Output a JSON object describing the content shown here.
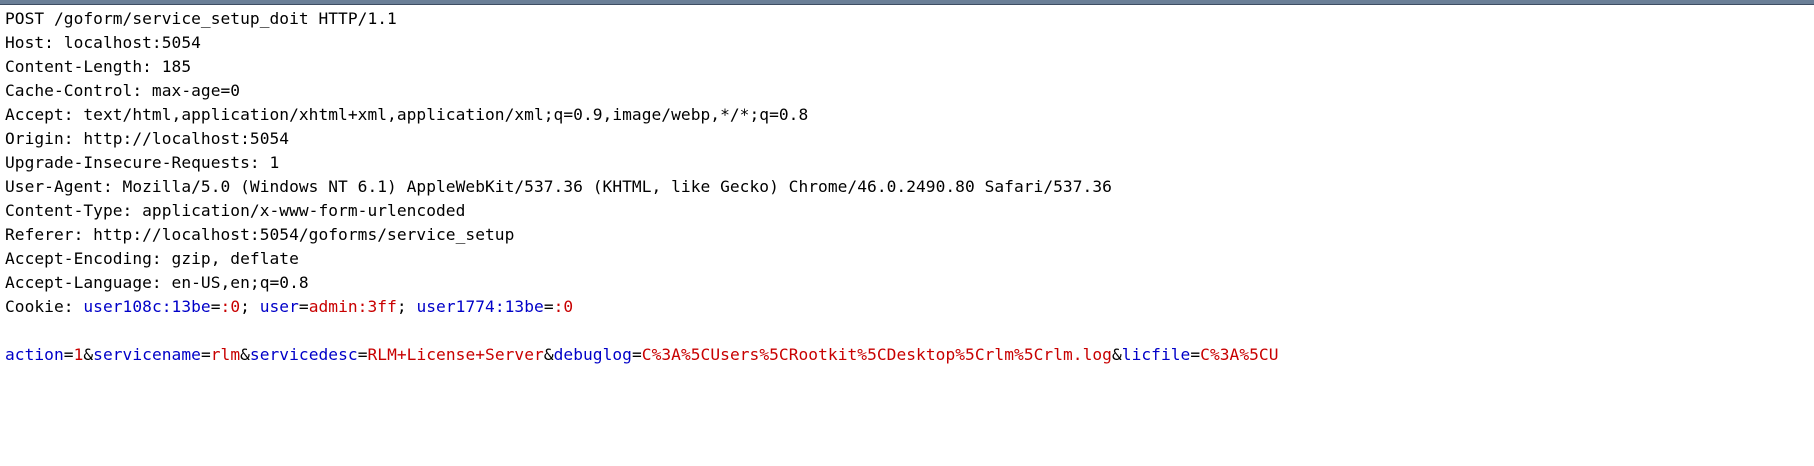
{
  "headers": [
    "POST /goform/service_setup_doit HTTP/1.1",
    "Host: localhost:5054",
    "Content-Length: 185",
    "Cache-Control: max-age=0",
    "Accept: text/html,application/xhtml+xml,application/xml;q=0.9,image/webp,*/*;q=0.8",
    "Origin: http://localhost:5054",
    "Upgrade-Insecure-Requests: 1",
    "User-Agent: Mozilla/5.0 (Windows NT 6.1) AppleWebKit/537.36 (KHTML, like Gecko) Chrome/46.0.2490.80 Safari/537.36",
    "Content-Type: application/x-www-form-urlencoded",
    "Referer: http://localhost:5054/goforms/service_setup",
    "Accept-Encoding: gzip, deflate",
    "Accept-Language: en-US,en;q=0.8"
  ],
  "cookie": {
    "label": "Cookie: ",
    "c1_name": "user108c:13be",
    "eq1": "=",
    "c1_value": ":0",
    "sep1": "; ",
    "c2_name": "user",
    "eq2": "=",
    "c2_value": "admin:3ff",
    "sep2": "; ",
    "c3_name": "user1774:13be",
    "eq3": "=",
    "c3_value": ":0"
  },
  "body": {
    "p1_name": "action",
    "p1_eq": "=",
    "p1_value": "1",
    "amp1": "&",
    "p2_name": "servicename",
    "p2_eq": "=",
    "p2_value": "rlm",
    "amp2": "&",
    "p3_name": "servicedesc",
    "p3_eq": "=",
    "p3_value": "RLM+License+Server",
    "amp3": "&",
    "p4_name": "debuglog",
    "p4_eq": "=",
    "p4_value": "C%3A%5CUsers%5CRootkit%5CDesktop%5Crlm%5Crlm.log",
    "amp4": "&",
    "p5_name": "licfile",
    "p5_eq": "=",
    "p5_value": "C%3A%5CU"
  },
  "colors": {
    "param_name": "#0000c8",
    "param_value": "#c80000",
    "window_border": "#6b7f97"
  }
}
